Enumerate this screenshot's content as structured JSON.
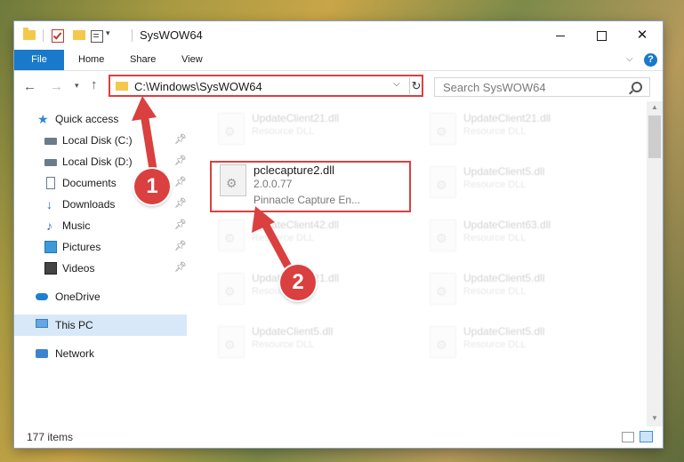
{
  "window": {
    "title": "SysWOW64"
  },
  "ribbon": {
    "tabs": [
      "File",
      "Home",
      "Share",
      "View"
    ],
    "help": "?"
  },
  "navbar": {
    "address": "C:\\Windows\\SysWOW64",
    "search_placeholder": "Search SysWOW64"
  },
  "sidebar": {
    "items": [
      {
        "label": "Quick access",
        "icon": "star-icon",
        "pinned": false
      },
      {
        "label": "Local Disk (C:)",
        "icon": "disk-icon",
        "pinned": true
      },
      {
        "label": "Local Disk (D:)",
        "icon": "disk-icon",
        "pinned": true
      },
      {
        "label": "Documents",
        "icon": "documents-icon",
        "pinned": true
      },
      {
        "label": "Downloads",
        "icon": "downloads-icon",
        "pinned": true
      },
      {
        "label": "Music",
        "icon": "music-icon",
        "pinned": true
      },
      {
        "label": "Pictures",
        "icon": "pictures-icon",
        "pinned": true
      },
      {
        "label": "Videos",
        "icon": "videos-icon",
        "pinned": true
      },
      {
        "label": "OneDrive",
        "icon": "onedrive-icon",
        "pinned": false
      },
      {
        "label": "This PC",
        "icon": "this-pc-icon",
        "pinned": false
      },
      {
        "label": "Network",
        "icon": "network-icon",
        "pinned": false
      }
    ]
  },
  "files": {
    "left": [
      {
        "name": "UpdateClient21.dll",
        "desc": "Resource DLL"
      },
      {
        "name": "pclecapture2.dll",
        "version": "2.0.0.77",
        "desc": "Pinnacle Capture En..."
      },
      {
        "name": "UpdateClient42.dll",
        "desc": "Resource DLL"
      },
      {
        "name": "UpdateClient21.dll",
        "desc": "Resource DLL"
      },
      {
        "name": "UpdateClient5.dll",
        "desc": "Resource DLL"
      }
    ],
    "right": [
      {
        "name": "UpdateClient21.dll",
        "desc": "Resource DLL"
      },
      {
        "name": "UpdateClient5.dll",
        "desc": "Resource DLL"
      },
      {
        "name": "UpdateClient63.dll",
        "desc": "Resource DLL"
      },
      {
        "name": "UpdateClient5.dll",
        "desc": "Resource DLL"
      },
      {
        "name": "UpdateClient5.dll",
        "desc": "Resource DLL"
      }
    ]
  },
  "status": {
    "count": "177 items"
  },
  "annotations": {
    "badge1": "1",
    "badge2": "2",
    "color": "#d9403f"
  }
}
